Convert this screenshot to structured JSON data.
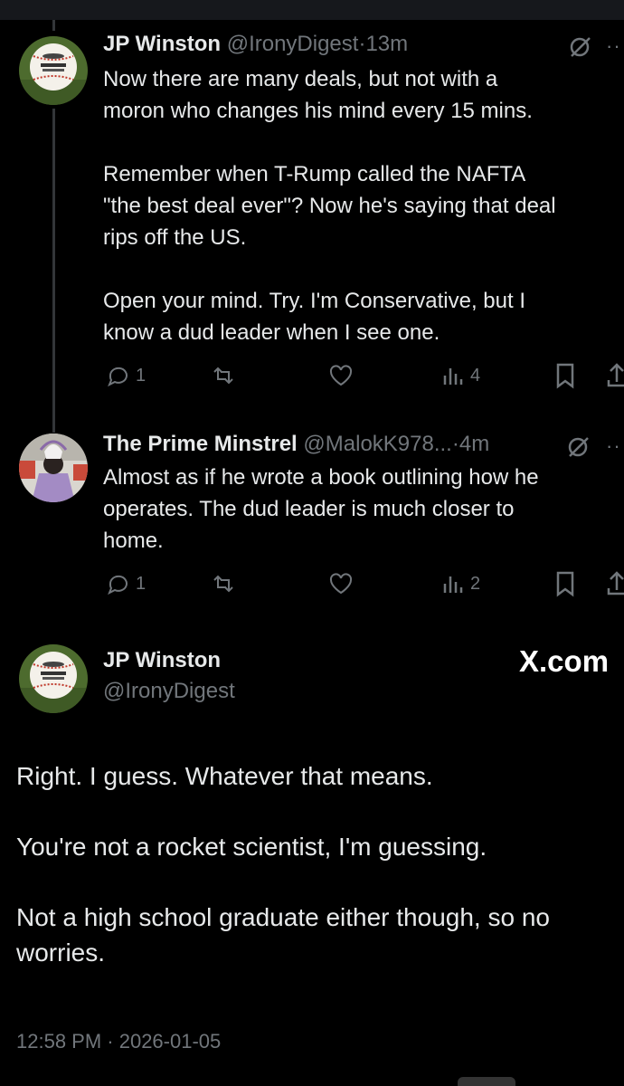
{
  "tweets": [
    {
      "name": "JP Winston",
      "handle": "@IronyDigest",
      "time": "13m",
      "text": "Now there are many deals, but not with a\nmoron who changes his mind every 15 mins.\n\nRemember when T-Rump called the NAFTA\n\"the best deal ever\"? Now he's saying that deal\nrips off the US.\n\nOpen your mind. Try. I'm Conservative, but I\nknow a dud leader when I see one.",
      "replies": "1",
      "views": "4"
    },
    {
      "name": "The Prime Minstrel",
      "handle": "@MalokK978...",
      "time": "4m",
      "text": "Almost as if he wrote a book outlining how he\noperates. The dud leader is much closer to\nhome.",
      "replies": "1",
      "views": "2"
    }
  ],
  "main_tweet": {
    "name": "JP Winston",
    "handle": "@IronyDigest",
    "watermark": "X.com",
    "text": "Right. I guess. Whatever that means.\n\nYou're not a rocket scientist, I'm guessing.\n\nNot a high school graduate either though, so no\nworries.",
    "timestamp": "12:58 PM · 2026-01-05"
  },
  "separator": "·",
  "colors": {
    "background": "#000000",
    "text": "#e7e9ea",
    "muted": "#71767b",
    "line": "#333639"
  }
}
